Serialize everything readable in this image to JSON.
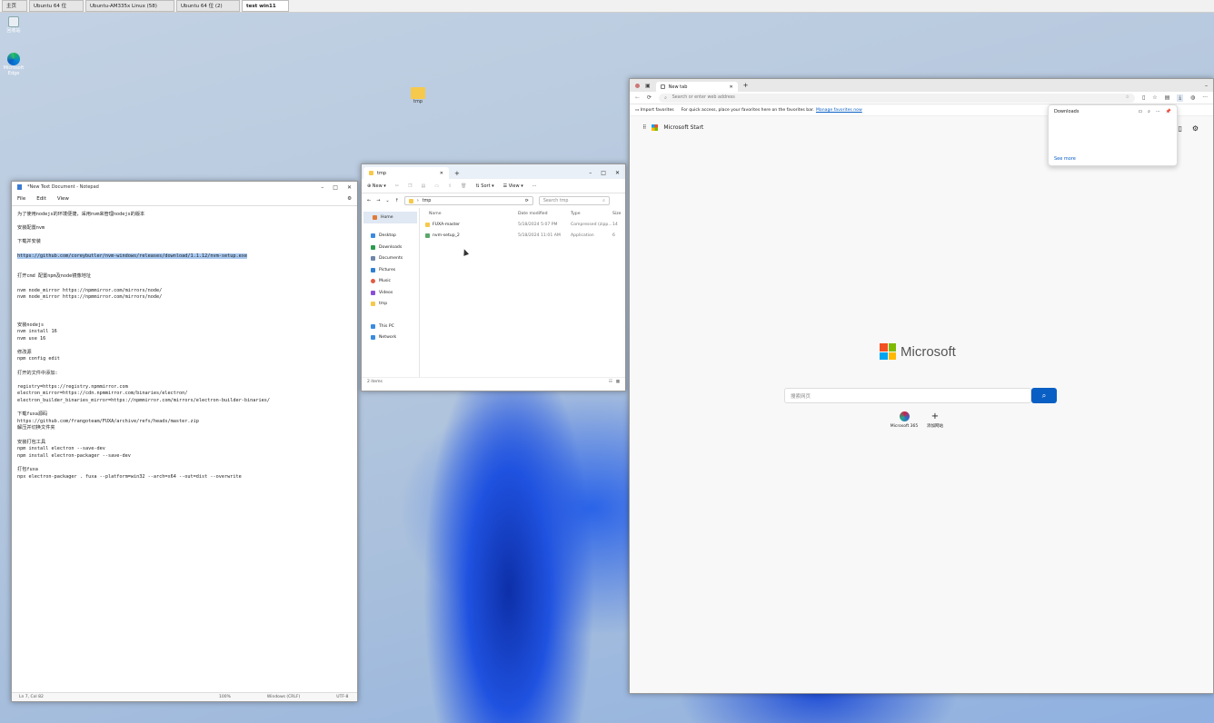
{
  "vm_tabs": [
    "主页",
    "Ubuntu 64 位",
    "Ubuntu-AM335x Linux (58)",
    "Ubuntu 64 位 (2)",
    "test win11"
  ],
  "desktop": {
    "icons": [
      {
        "label": "回收站"
      },
      {
        "label": "Microsoft Edge"
      },
      {
        "label": "tmp"
      }
    ]
  },
  "notepad": {
    "title": "*New Text Document - Notepad",
    "menu": [
      "File",
      "Edit",
      "View"
    ],
    "lines": [
      "为了使用nodejs的环境便捷，采用nvm来管理nodejs的版本",
      "",
      "安装配置nvm",
      "",
      "下载并安装",
      "",
      "https://github.com/coreybutler/nvm-windows/releases/download/1.1.12/nvm-setup.exe",
      "",
      "",
      "打开cmd 配置npm及node镜像地址",
      "",
      "nvm node_mirror https://npmmirror.com/mirrors/node/",
      "nvm node_mirror https://npmmirror.com/mirrors/node/",
      "",
      "",
      "",
      "安装nodejs",
      "nvm install 16",
      "nvm use 16",
      "",
      "修改源",
      "npm config edit",
      "",
      "打开的文件中添加:",
      "",
      "registry=https://registry.npmmirror.com",
      "electron_mirror=https://cdn.npmmirror.com/binaries/electron/",
      "electron_builder_binaries_mirror=https://npmmirror.com/mirrors/electron-builder-binaries/",
      "",
      "下载fuxa源码",
      "https://github.com/frangoteam/FUXA/archive/refs/heads/master.zip",
      "解压并切换文件夹",
      "",
      "安装打包工具",
      "npm install electron --save-dev",
      "npm install electron-packager --save-dev",
      "",
      "打包fuxa",
      "npx electron-packager . fuxa --platform=win32 --arch=x64 --out=dist --overwrite"
    ],
    "status": {
      "pos": "Ln 7, Col 82",
      "zoom": "100%",
      "eol": "Windows (CRLF)",
      "enc": "UTF-8"
    }
  },
  "explorer": {
    "tab": "tmp",
    "new": "New",
    "sort": "Sort",
    "view": "View",
    "path": "tmp",
    "search": "Search tmp",
    "cols": [
      "Name",
      "Date modified",
      "Type",
      "Size"
    ],
    "rows": [
      {
        "name": "FUXA-master",
        "date": "5/18/2024 5:07 PM",
        "type": "Compressed (zipp...",
        "size": "14"
      },
      {
        "name": "nvm-setup_2",
        "date": "5/18/2024 11:01 AM",
        "type": "Application",
        "size": "6"
      }
    ],
    "nav": [
      "Home",
      "Desktop",
      "Downloads",
      "Documents",
      "Pictures",
      "Music",
      "Videos",
      "tmp",
      "This PC",
      "Network"
    ],
    "count": "2 items"
  },
  "edge": {
    "tab": "New tab",
    "address": "Search or enter web address",
    "import": "Import favorites",
    "fav_msg": "For quick access, place your favorites here on the favorites bar.",
    "fav_link": "Manage favorites now",
    "start": "Microsoft Start",
    "logo": "Microsoft",
    "search_ph": "搜索网页",
    "tiles": [
      {
        "label": "Microsoft 365"
      },
      {
        "label": "添加网站"
      }
    ],
    "downloads": {
      "title": "Downloads",
      "see_more": "See more"
    }
  }
}
